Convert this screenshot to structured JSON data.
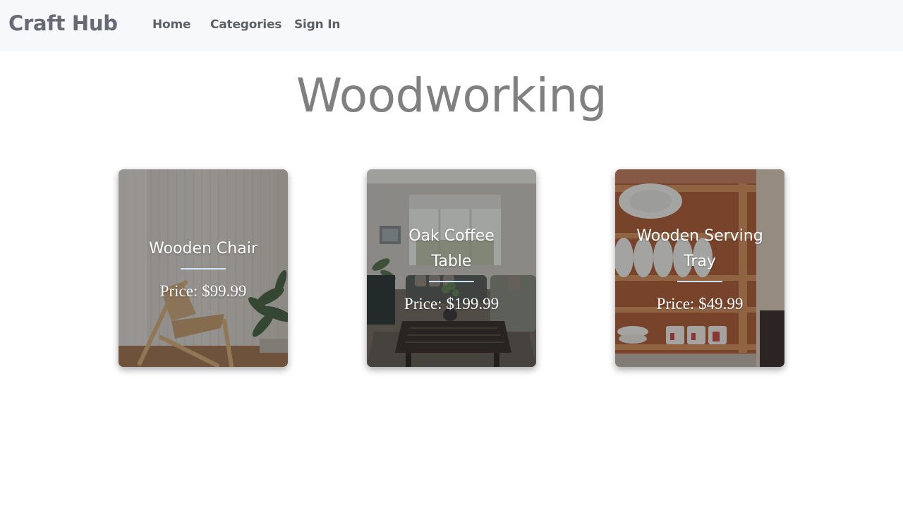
{
  "navbar": {
    "brand": "Craft Hub",
    "links": [
      "Home",
      "Categories",
      "Sign In"
    ]
  },
  "page": {
    "title": "Woodworking"
  },
  "products": [
    {
      "name": "Wooden Chair",
      "price": "Price: $99.99"
    },
    {
      "name": "Oak Coffee Table",
      "price": "Price: $199.99"
    },
    {
      "name": "Wooden Serving Tray",
      "price": "Price: $49.99"
    }
  ],
  "colors": {
    "navbar_bg": "#f7f8f9",
    "brand_text": "#666b73",
    "title_text": "#808080",
    "divider": "#cfe4f5"
  }
}
